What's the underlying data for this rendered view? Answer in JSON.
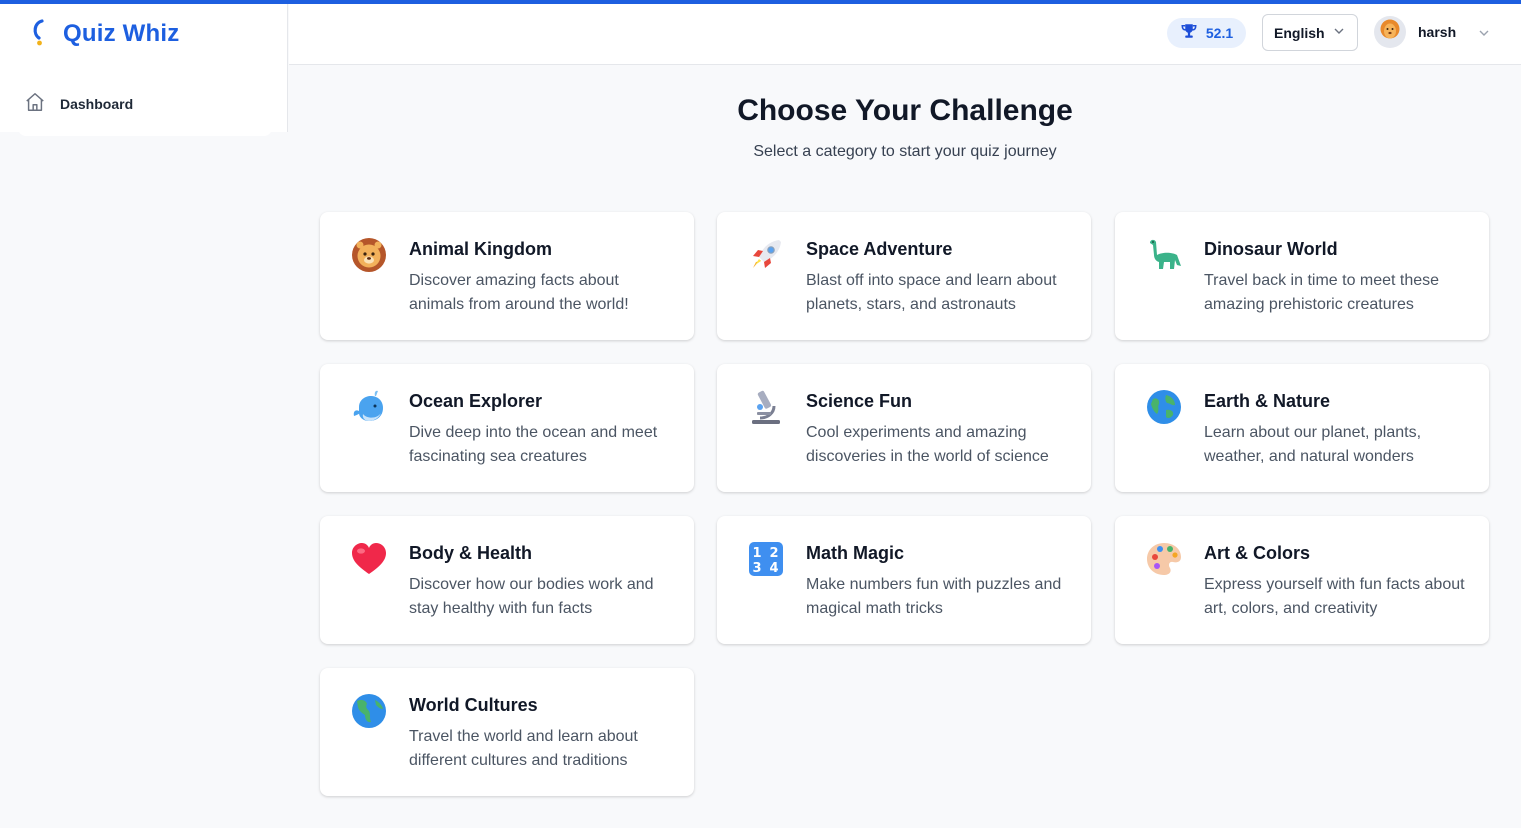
{
  "app": {
    "name": "Quiz Whiz",
    "accent_color": "#1d5fe0"
  },
  "sidebar": {
    "items": [
      {
        "label": "Dashboard",
        "icon": "home-icon"
      }
    ]
  },
  "header": {
    "score": "52.1",
    "score_icon": "trophy-icon",
    "language": "English",
    "user_name": "harsh",
    "avatar_icon": "lion-avatar-icon"
  },
  "main": {
    "title": "Choose Your Challenge",
    "subtitle": "Select a category to start your quiz journey",
    "categories": [
      {
        "title": "Animal Kingdom",
        "description": "Discover amazing facts about animals from around the world!",
        "icon": "lion-icon"
      },
      {
        "title": "Space Adventure",
        "description": "Blast off into space and learn about planets, stars, and astronauts",
        "icon": "rocket-icon"
      },
      {
        "title": "Dinosaur World",
        "description": "Travel back in time to meet these amazing prehistoric creatures",
        "icon": "dinosaur-icon"
      },
      {
        "title": "Ocean Explorer",
        "description": "Dive deep into the ocean and meet fascinating sea creatures",
        "icon": "whale-icon"
      },
      {
        "title": "Science Fun",
        "description": "Cool experiments and amazing discoveries in the world of science",
        "icon": "microscope-icon"
      },
      {
        "title": "Earth & Nature",
        "description": "Learn about our planet, plants, weather, and natural wonders",
        "icon": "globe-icon"
      },
      {
        "title": "Body & Health",
        "description": "Discover how our bodies work and stay healthy with fun facts",
        "icon": "heart-icon"
      },
      {
        "title": "Math Magic",
        "description": "Make numbers fun with puzzles and magical math tricks",
        "icon": "numbers-icon"
      },
      {
        "title": "Art & Colors",
        "description": "Express yourself with fun facts about art, colors, and creativity",
        "icon": "palette-icon"
      },
      {
        "title": "World Cultures",
        "description": "Travel the world and learn about different cultures and traditions",
        "icon": "globe-americas-icon"
      }
    ]
  }
}
